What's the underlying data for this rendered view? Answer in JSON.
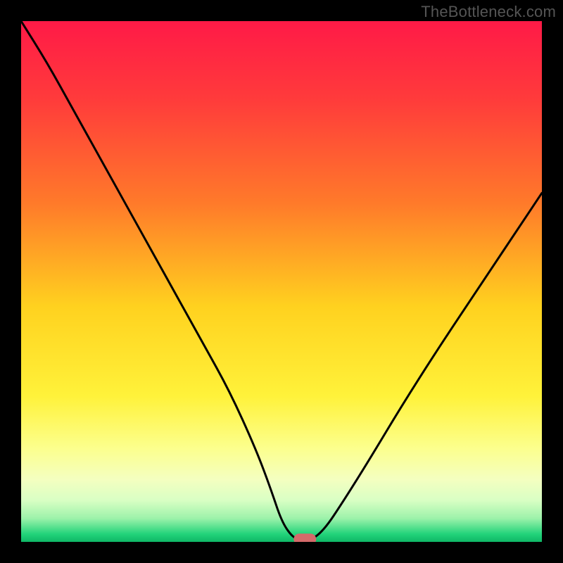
{
  "watermark": "TheBottleneck.com",
  "chart_data": {
    "type": "line",
    "title": "",
    "xlabel": "",
    "ylabel": "",
    "xlim": [
      0,
      100
    ],
    "ylim": [
      0,
      100
    ],
    "grid": false,
    "legend": false,
    "series": [
      {
        "name": "bottleneck-curve",
        "x": [
          0,
          5,
          10,
          15,
          20,
          25,
          30,
          35,
          40,
          45,
          48,
          50,
          52,
          54,
          55,
          58,
          62,
          67,
          73,
          80,
          88,
          96,
          100
        ],
        "y": [
          100,
          92,
          83,
          74,
          65,
          56,
          47,
          38,
          29,
          18,
          10,
          4,
          1,
          0,
          0,
          2,
          8,
          16,
          26,
          37,
          49,
          61,
          67
        ]
      }
    ],
    "marker": {
      "x": 54.5,
      "y": 0.5,
      "color": "#d46a6a"
    },
    "background_gradient": {
      "stops": [
        {
          "offset": 0.0,
          "color": "#ff1a47"
        },
        {
          "offset": 0.15,
          "color": "#ff3b3b"
        },
        {
          "offset": 0.35,
          "color": "#ff7a2a"
        },
        {
          "offset": 0.55,
          "color": "#ffd21f"
        },
        {
          "offset": 0.72,
          "color": "#fff23a"
        },
        {
          "offset": 0.82,
          "color": "#fcff8d"
        },
        {
          "offset": 0.88,
          "color": "#f4ffc0"
        },
        {
          "offset": 0.92,
          "color": "#d9ffc4"
        },
        {
          "offset": 0.955,
          "color": "#9cf2aa"
        },
        {
          "offset": 0.985,
          "color": "#22d37a"
        },
        {
          "offset": 1.0,
          "color": "#0fb766"
        }
      ]
    }
  }
}
